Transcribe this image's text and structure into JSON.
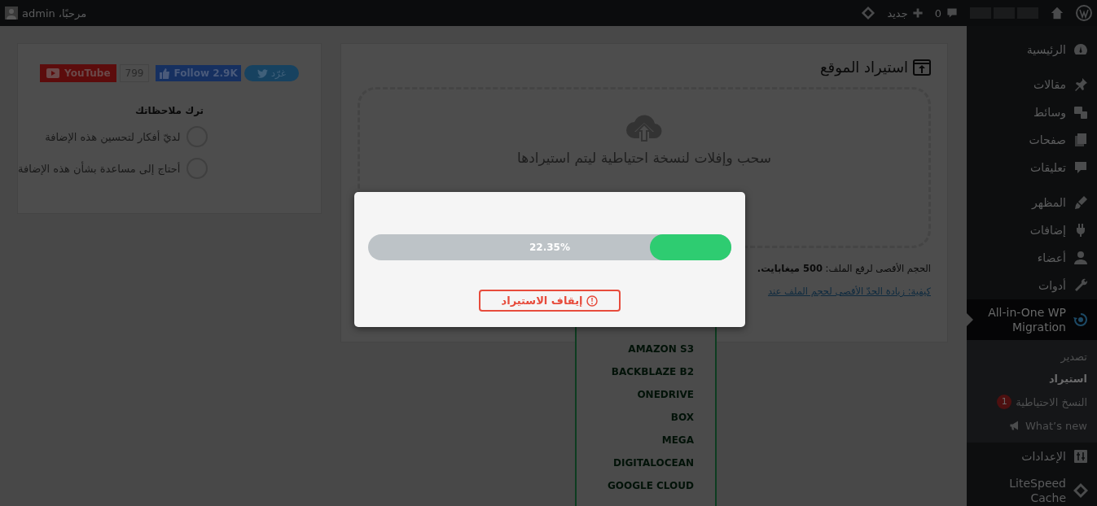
{
  "admin_bar": {
    "greeting": "مرحبًا، admin",
    "comments_count": "0",
    "new_label": "جديد"
  },
  "sidebar": {
    "groups": [
      [
        {
          "label": "الرئيسية",
          "selected": false
        }
      ],
      [
        {
          "label": "مقالات",
          "selected": false
        },
        {
          "label": "وسائط",
          "selected": false
        },
        {
          "label": "صفحات",
          "selected": false
        },
        {
          "label": "تعليقات",
          "selected": false
        }
      ],
      [
        {
          "label": "المظهر",
          "selected": false
        },
        {
          "label": "إضافات",
          "selected": false
        },
        {
          "label": "أعضاء",
          "selected": false
        },
        {
          "label": "أدوات",
          "selected": false
        },
        {
          "label": "All-in-One WP Migration",
          "selected": true,
          "children": [
            {
              "label": "تصدير",
              "selected": false
            },
            {
              "label": "استيراد",
              "selected": true
            },
            {
              "label": "النسخ الاحتياطية",
              "badge": "1",
              "selected": false
            },
            {
              "label": "What’s new",
              "selected": false
            }
          ]
        },
        {
          "label": "الإعدادات",
          "selected": false
        },
        {
          "label": "LiteSpeed Cache",
          "selected": false
        }
      ]
    ]
  },
  "feedback_panel": {
    "youtube_label": "YouTube",
    "youtube_count": "799",
    "facebook_label": "Follow 2.9K",
    "twitter_label": "غرّد",
    "heading": "ترك ملاحظاتك",
    "options": [
      {
        "label": "لديّ أفكار لتحسين هذه الإضافة",
        "selected": false
      },
      {
        "label": "أحتاج إلى مساعدة بشأن هذه الإضافة",
        "selected": false
      }
    ]
  },
  "import_panel": {
    "title": "استيراد الموقع",
    "drop_text": "سحب وإفلات لنسخة احتياطية ليتم استيرادها",
    "max_size": "الحجم الأقصى لرفع الملف: **500 ميغابايت.**",
    "help_link": "كيفية: زيادة الحدّ الأقصى لحجم الملف عند"
  },
  "storage_menu": {
    "items": [
      "AMAZON S3",
      "BACKBLAZE B2",
      "ONEDRIVE",
      "BOX",
      "MEGA",
      "DIGITALOCEAN",
      "GOOGLE CLOUD"
    ]
  },
  "progress_dialog": {
    "level": 0.2235,
    "reading": "22.35%",
    "stop_button": "إيقاف الاستيراد"
  }
}
